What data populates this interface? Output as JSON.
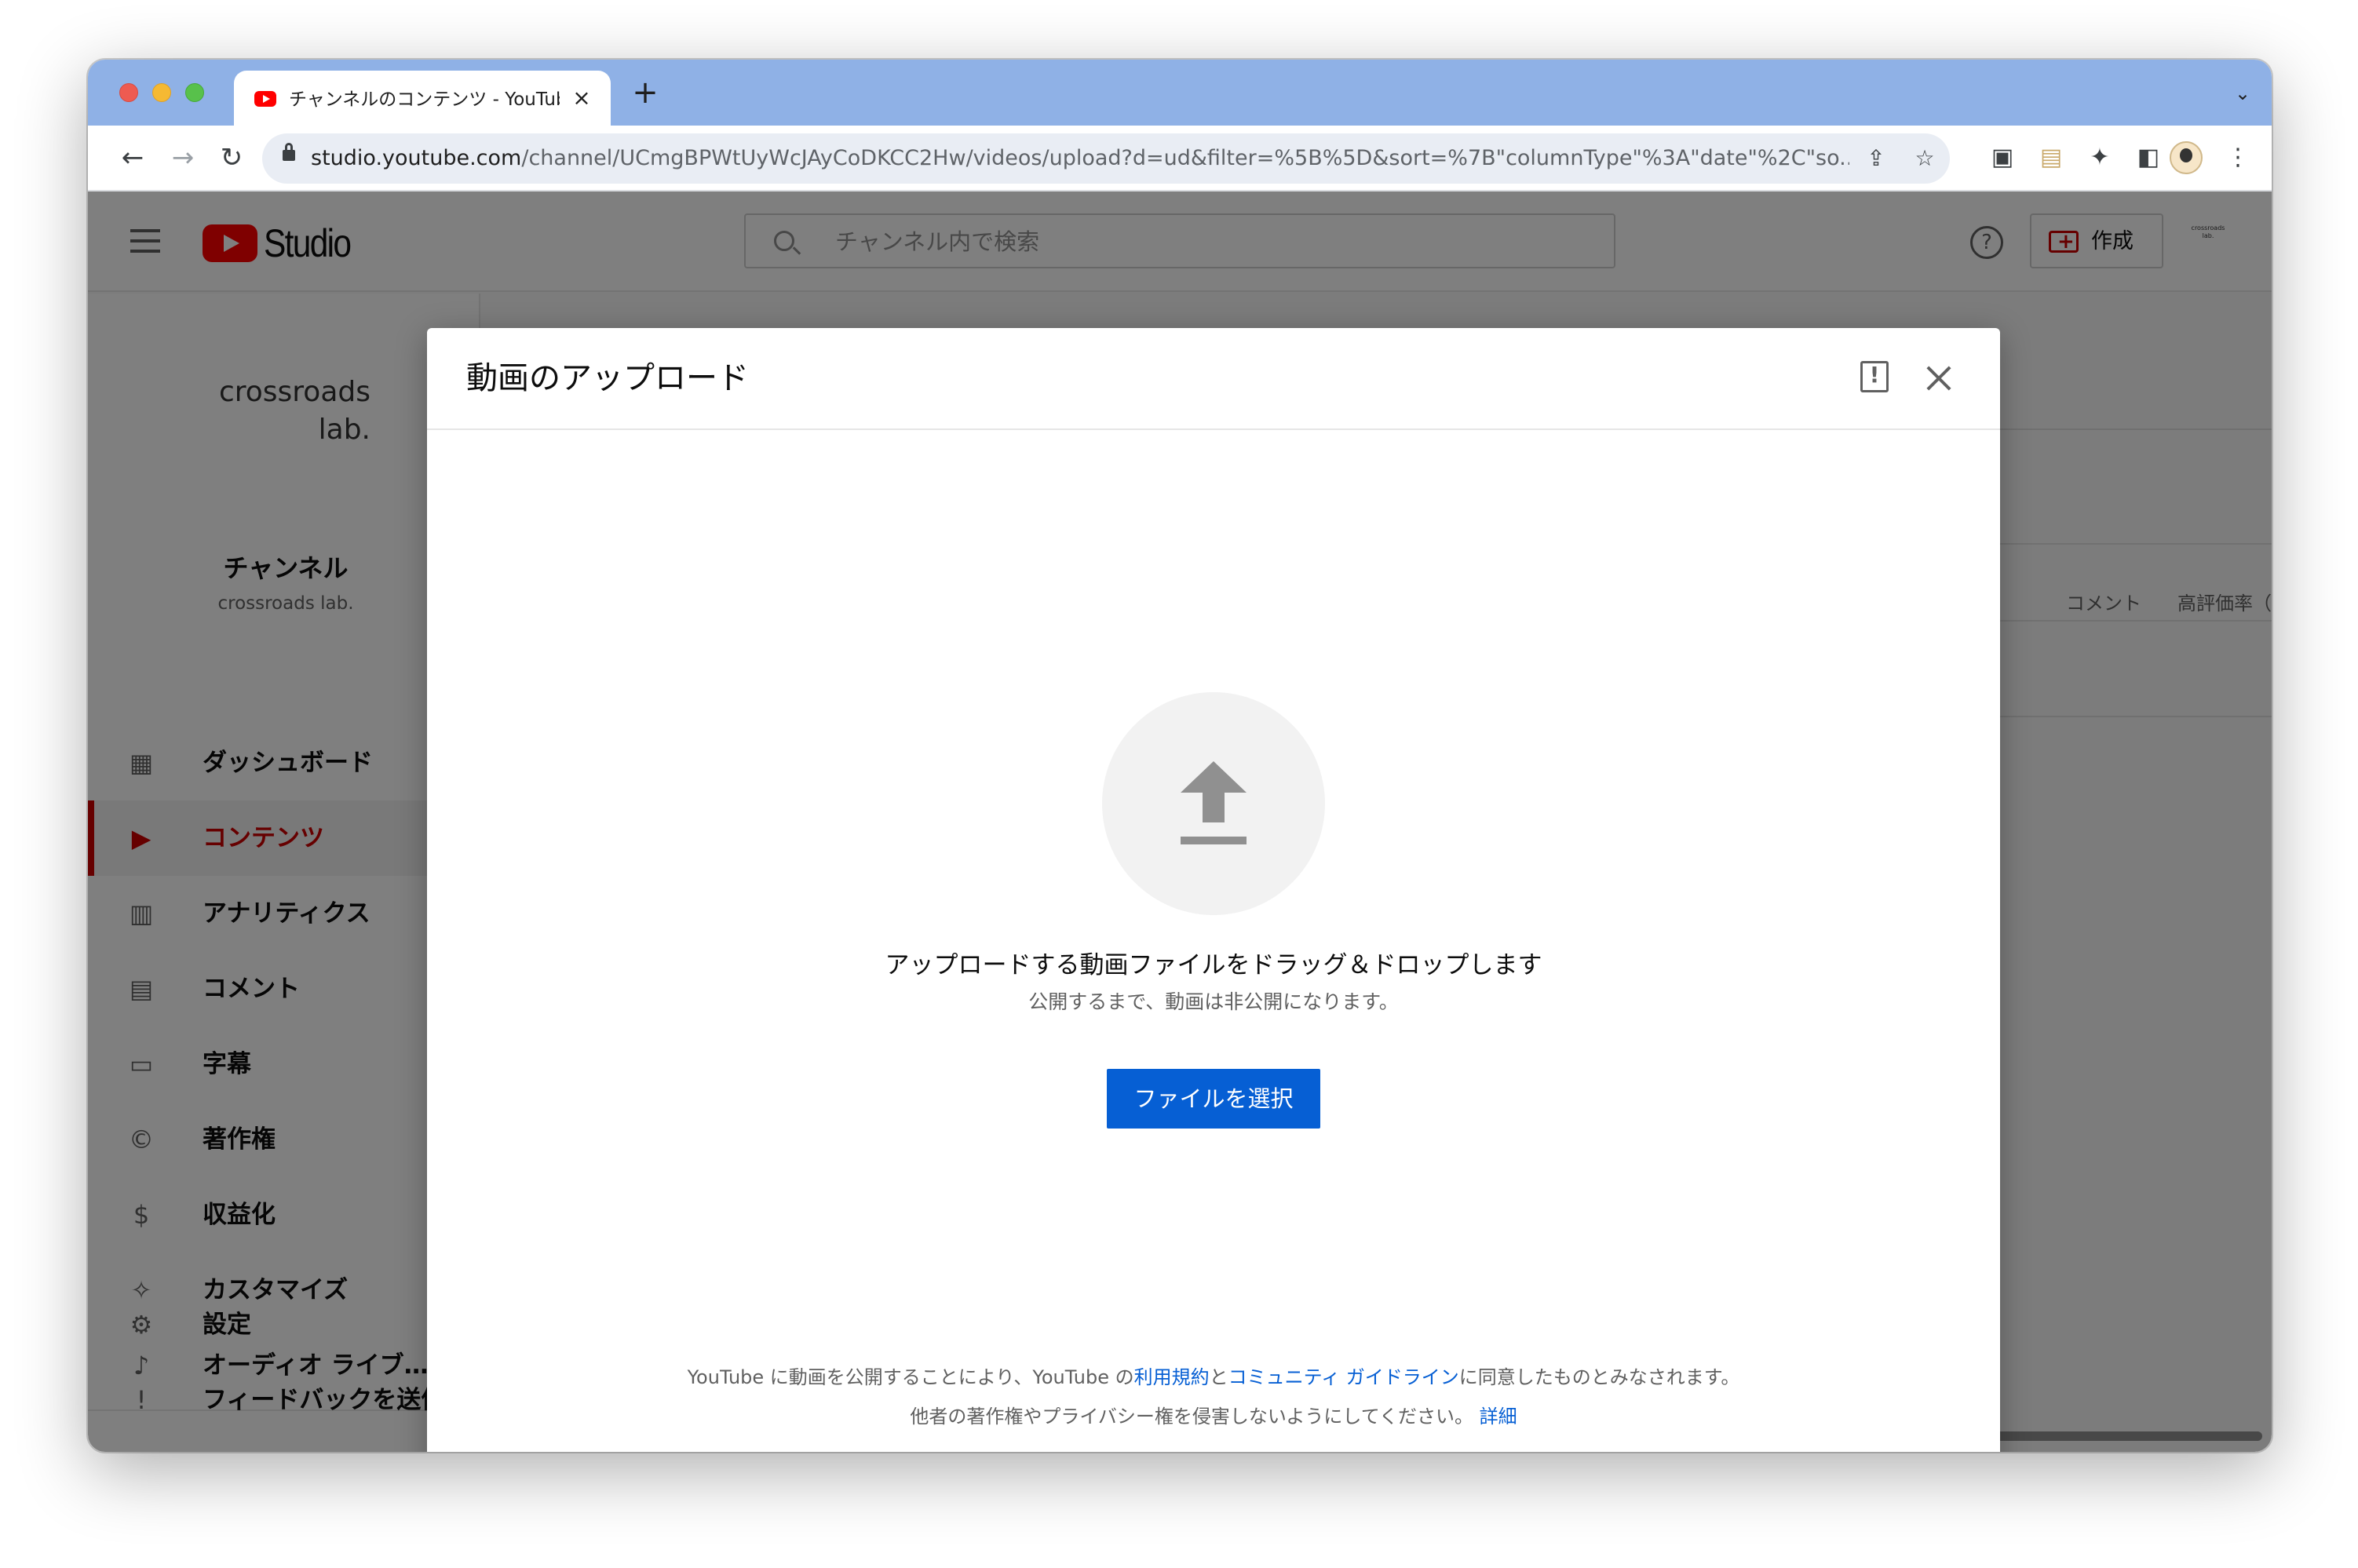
{
  "browser": {
    "tab_title": "チャンネルのコンテンツ - YouTube Studio",
    "tab_close": "×",
    "new_tab": "+",
    "url_host": "studio.youtube.com",
    "url_path": "/channel/UCmgBPWtUyWcJAyCoDKCC2Hw/videos/upload?d=ud&filter=%5B%5D&sort=%7B\"columnType\"%3A\"date\"%2C\"so..."
  },
  "studio": {
    "logo_text": "Studio",
    "search_placeholder": "チャンネル内で検索",
    "create_label": "作成",
    "avatar_text": "crossroads lab.",
    "channel_name_line1": "crossroads",
    "channel_name_line2": "lab.",
    "channel_label": "チャンネル",
    "channel_sub": "crossroads lab.",
    "nav": [
      {
        "label": "ダッシュボード",
        "icon": "dashboard-icon"
      },
      {
        "label": "コンテンツ",
        "icon": "content-icon",
        "active": true
      },
      {
        "label": "アナリティクス",
        "icon": "analytics-icon"
      },
      {
        "label": "コメント",
        "icon": "comments-icon"
      },
      {
        "label": "字幕",
        "icon": "subtitles-icon"
      },
      {
        "label": "著作権",
        "icon": "copyright-icon"
      },
      {
        "label": "収益化",
        "icon": "monetization-icon"
      },
      {
        "label": "カスタマイズ",
        "icon": "customize-icon"
      },
      {
        "label": "オーディオ ライブ…",
        "icon": "audio-library-icon"
      },
      {
        "label": "設定",
        "icon": "settings-icon"
      },
      {
        "label": "フィードバックを送信",
        "icon": "feedback-icon"
      }
    ],
    "columns": [
      "コメント",
      "高評価率（低評…"
    ]
  },
  "dialog": {
    "title": "動画のアップロード",
    "drop_text": "アップロードする動画ファイルをドラッグ＆ドロップします",
    "drop_sub": "公開するまで、動画は非公開になります。",
    "select_button": "ファイルを選択",
    "legal": {
      "part1": "YouTube に動画を公開することにより、YouTube の",
      "terms_link": "利用規約",
      "part2": "と",
      "guidelines_link": "コミュニティ ガイドライン",
      "part3": "に同意したものとみなされます。",
      "line2": "他者の著作権やプライバシー権を侵害しないようにしてください。",
      "details_link": "詳細"
    }
  },
  "colors": {
    "tabstrip": "#8fb1e6",
    "accent_blue": "#065fd4",
    "studio_red": "#cc0000"
  }
}
